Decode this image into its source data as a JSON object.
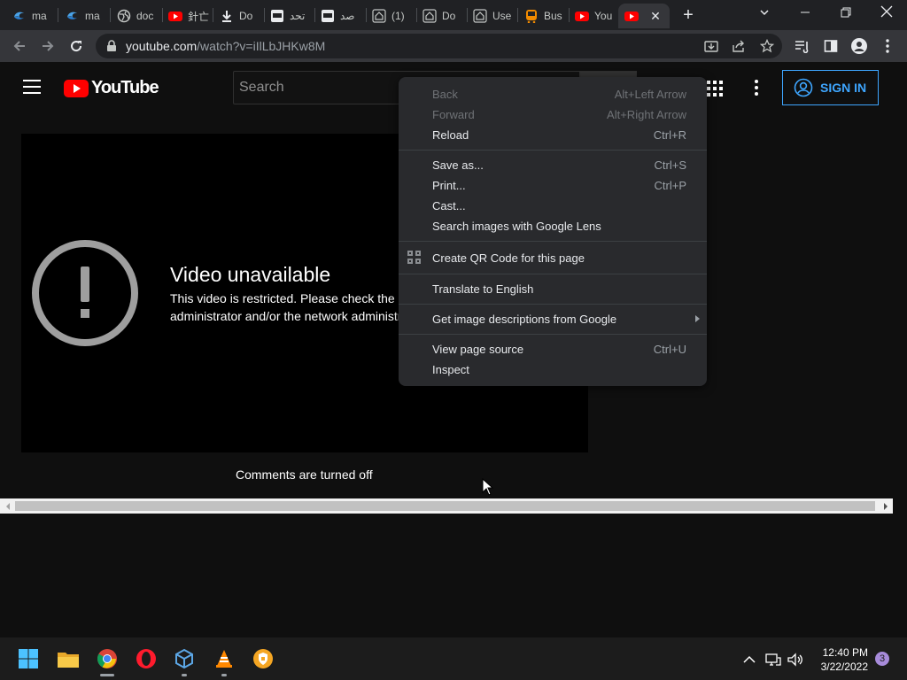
{
  "browser": {
    "tabs": [
      {
        "title": "ma",
        "icon": "edge-blue-icon"
      },
      {
        "title": "ma",
        "icon": "edge-blue-icon"
      },
      {
        "title": "doc",
        "icon": "globe-icon"
      },
      {
        "title": "針亡",
        "icon": "youtube-icon"
      },
      {
        "title": "Do",
        "icon": "download-icon"
      },
      {
        "title": "تحد",
        "icon": "app-icon"
      },
      {
        "title": "صد",
        "icon": "app-icon"
      },
      {
        "title": "(1)",
        "icon": "home-icon"
      },
      {
        "title": "Do",
        "icon": "home-icon"
      },
      {
        "title": "Use",
        "icon": "home-icon"
      },
      {
        "title": "Bus",
        "icon": "bus-icon"
      },
      {
        "title": "You",
        "icon": "youtube-icon"
      },
      {
        "title": "",
        "icon": "youtube-icon",
        "active": true
      }
    ],
    "url_host": "youtube.com",
    "url_path": "/watch?v=iIlLbJHKw8M"
  },
  "youtube": {
    "logo_text": "YouTube",
    "search_placeholder": "Search",
    "sign_in_label": "SIGN IN"
  },
  "player": {
    "error_title": "Video unavailable",
    "error_message": "This video is restricted. Please check the Google Workspace administrator and/or the network administrator restrictions.",
    "comments_status": "Comments are turned off"
  },
  "context_menu": {
    "items": [
      {
        "label": "Back",
        "shortcut": "Alt+Left Arrow",
        "disabled": true
      },
      {
        "label": "Forward",
        "shortcut": "Alt+Right Arrow",
        "disabled": true
      },
      {
        "label": "Reload",
        "shortcut": "Ctrl+R"
      },
      {
        "label": "Save as...",
        "shortcut": "Ctrl+S"
      },
      {
        "label": "Print...",
        "shortcut": "Ctrl+P"
      },
      {
        "label": "Cast..."
      },
      {
        "label": "Search images with Google Lens"
      },
      {
        "label": "Create QR Code for this page"
      },
      {
        "label": "Translate to English"
      },
      {
        "label": "Get image descriptions from Google"
      },
      {
        "label": "View page source",
        "shortcut": "Ctrl+U"
      },
      {
        "label": "Inspect"
      }
    ]
  },
  "taskbar": {
    "time": "12:40 PM",
    "date": "3/22/2022",
    "notification_count": "3",
    "apps": [
      "start-icon",
      "file-explorer-icon",
      "chrome-icon",
      "opera-icon",
      "virtualbox-icon",
      "vlc-icon",
      "vpn-shield-icon"
    ]
  },
  "colors": {
    "accent": "#3ea6ff",
    "youtube_red": "#ff0000",
    "menu_bg": "#292a2d"
  }
}
